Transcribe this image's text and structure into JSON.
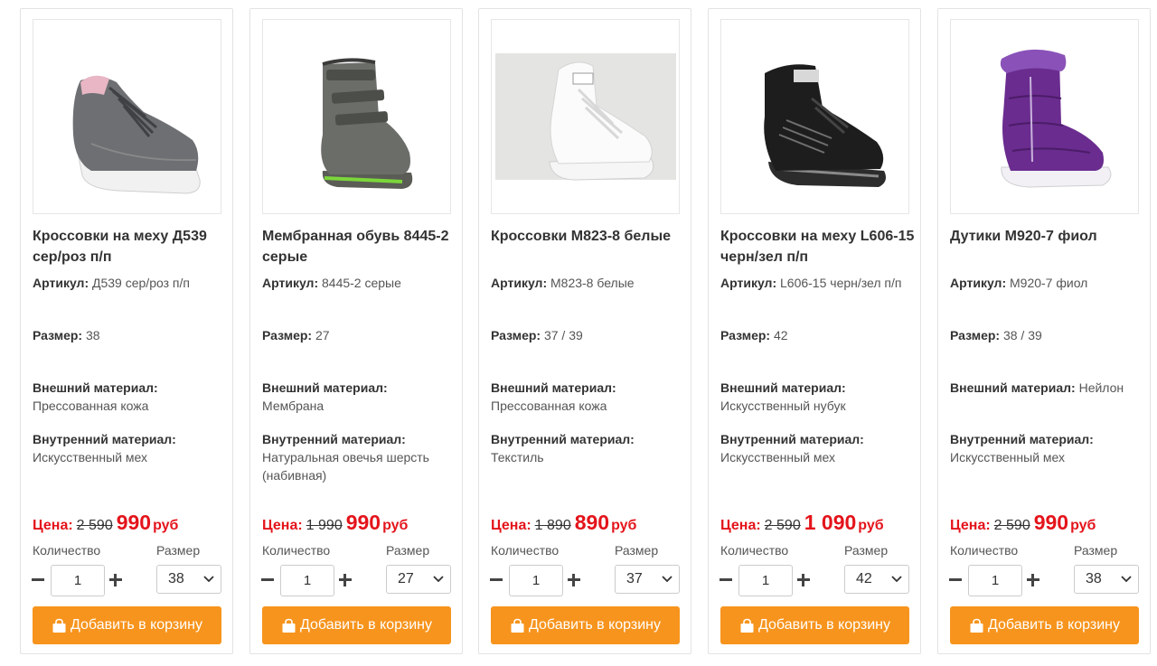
{
  "labels": {
    "article": "Артикул:",
    "size": "Размер:",
    "outer": "Внешний материал:",
    "inner": "Внутренний материал:",
    "price": "Цена:",
    "quantity": "Количество",
    "size_select": "Размер",
    "add_to_cart": "Добавить в корзину",
    "currency": "руб"
  },
  "products": [
    {
      "title": "Кроссовки на меху Д539 сер/роз п/п",
      "article": "Д539 сер/роз п/п",
      "size": "38",
      "outer": "Прессованная кожа",
      "inner": "Искусственный мех",
      "old_price": "2 590",
      "new_price": "990",
      "qty": "1",
      "size_selected": "38",
      "image": "grey-sneaker-icon"
    },
    {
      "title": "Мембранная обувь 8445-2 серые",
      "article": "8445-2 серые",
      "size": "27",
      "outer": "Мембрана",
      "inner": "Натуральная овечья шерсть (набивная)",
      "old_price": "1 990",
      "new_price": "990",
      "qty": "1",
      "size_selected": "27",
      "image": "grey-membrane-boot-icon"
    },
    {
      "title": "Кроссовки M823-8 белые",
      "article": "M823-8 белые",
      "size": "37 / 39",
      "outer": "Прессованная кожа",
      "inner": "Текстиль",
      "old_price": "1 890",
      "new_price": "890",
      "qty": "1",
      "size_selected": "37",
      "image": "white-sneaker-icon"
    },
    {
      "title": "Кроссовки на меху L606-15 черн/зел п/п",
      "article": "L606-15 черн/зел п/п",
      "size": "42",
      "outer": "Искусственный нубук",
      "inner": "Искусственный мех",
      "old_price": "2 590",
      "new_price": "1 090",
      "qty": "1",
      "size_selected": "42",
      "image": "black-high-sneaker-icon"
    },
    {
      "title": "Дутики M920-7 фиол",
      "article": "M920-7 фиол",
      "size": "38 / 39",
      "outer": "Нейлон",
      "inner": "Искусственный мех",
      "old_price": "2 590",
      "new_price": "990",
      "qty": "1",
      "size_selected": "38",
      "image": "purple-puffer-boot-icon"
    }
  ]
}
